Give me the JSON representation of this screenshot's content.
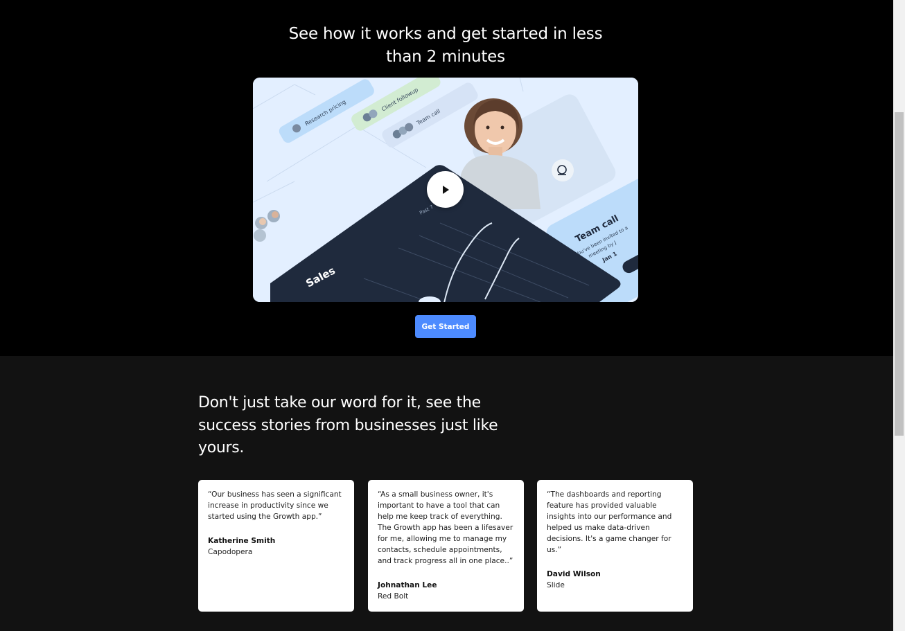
{
  "hero": {
    "title": "See how it works and get started in less than 2 minutes",
    "video": {
      "card_labels": {
        "research": "Research pricing",
        "client": "Client followup",
        "team": "Team call"
      },
      "sales_label": "Sales",
      "past_label": "Past 7",
      "team_call_title": "Team call",
      "team_call_line1": "You've been invited to a",
      "team_call_line2": "meeting by J",
      "team_call_line3": "Jan 1"
    },
    "cta_label": "Get Started"
  },
  "stories": {
    "title": "Don't just take our word for it, see the success stories from businesses just like yours.",
    "testimonials": [
      {
        "quote": "“Our business has seen a significant increase in productivity since we started using the Growth app.”",
        "name": "Katherine Smith",
        "company": "Capodopera"
      },
      {
        "quote": "“As a small business owner, it's important to have a tool that can help me keep track of everything. The Growth app has been a lifesaver for me, allowing me to manage my contacts, schedule appointments, and track progress all in one place..”",
        "name": "Johnathan Lee",
        "company": "Red Bolt"
      },
      {
        "quote": "“The dashboards and reporting feature has provided valuable insights into our performance and helped us make data-driven decisions. It's a game changer for us.”",
        "name": "David Wilson",
        "company": "Slide"
      }
    ]
  },
  "colors": {
    "accent": "#4d8bff",
    "hero_bg": "#000000",
    "stories_bg": "#121212",
    "card_bg": "#ffffff",
    "dashboard_navy": "#1f2a3d"
  },
  "icons": {
    "play": "play-icon",
    "record": "record-icon"
  }
}
